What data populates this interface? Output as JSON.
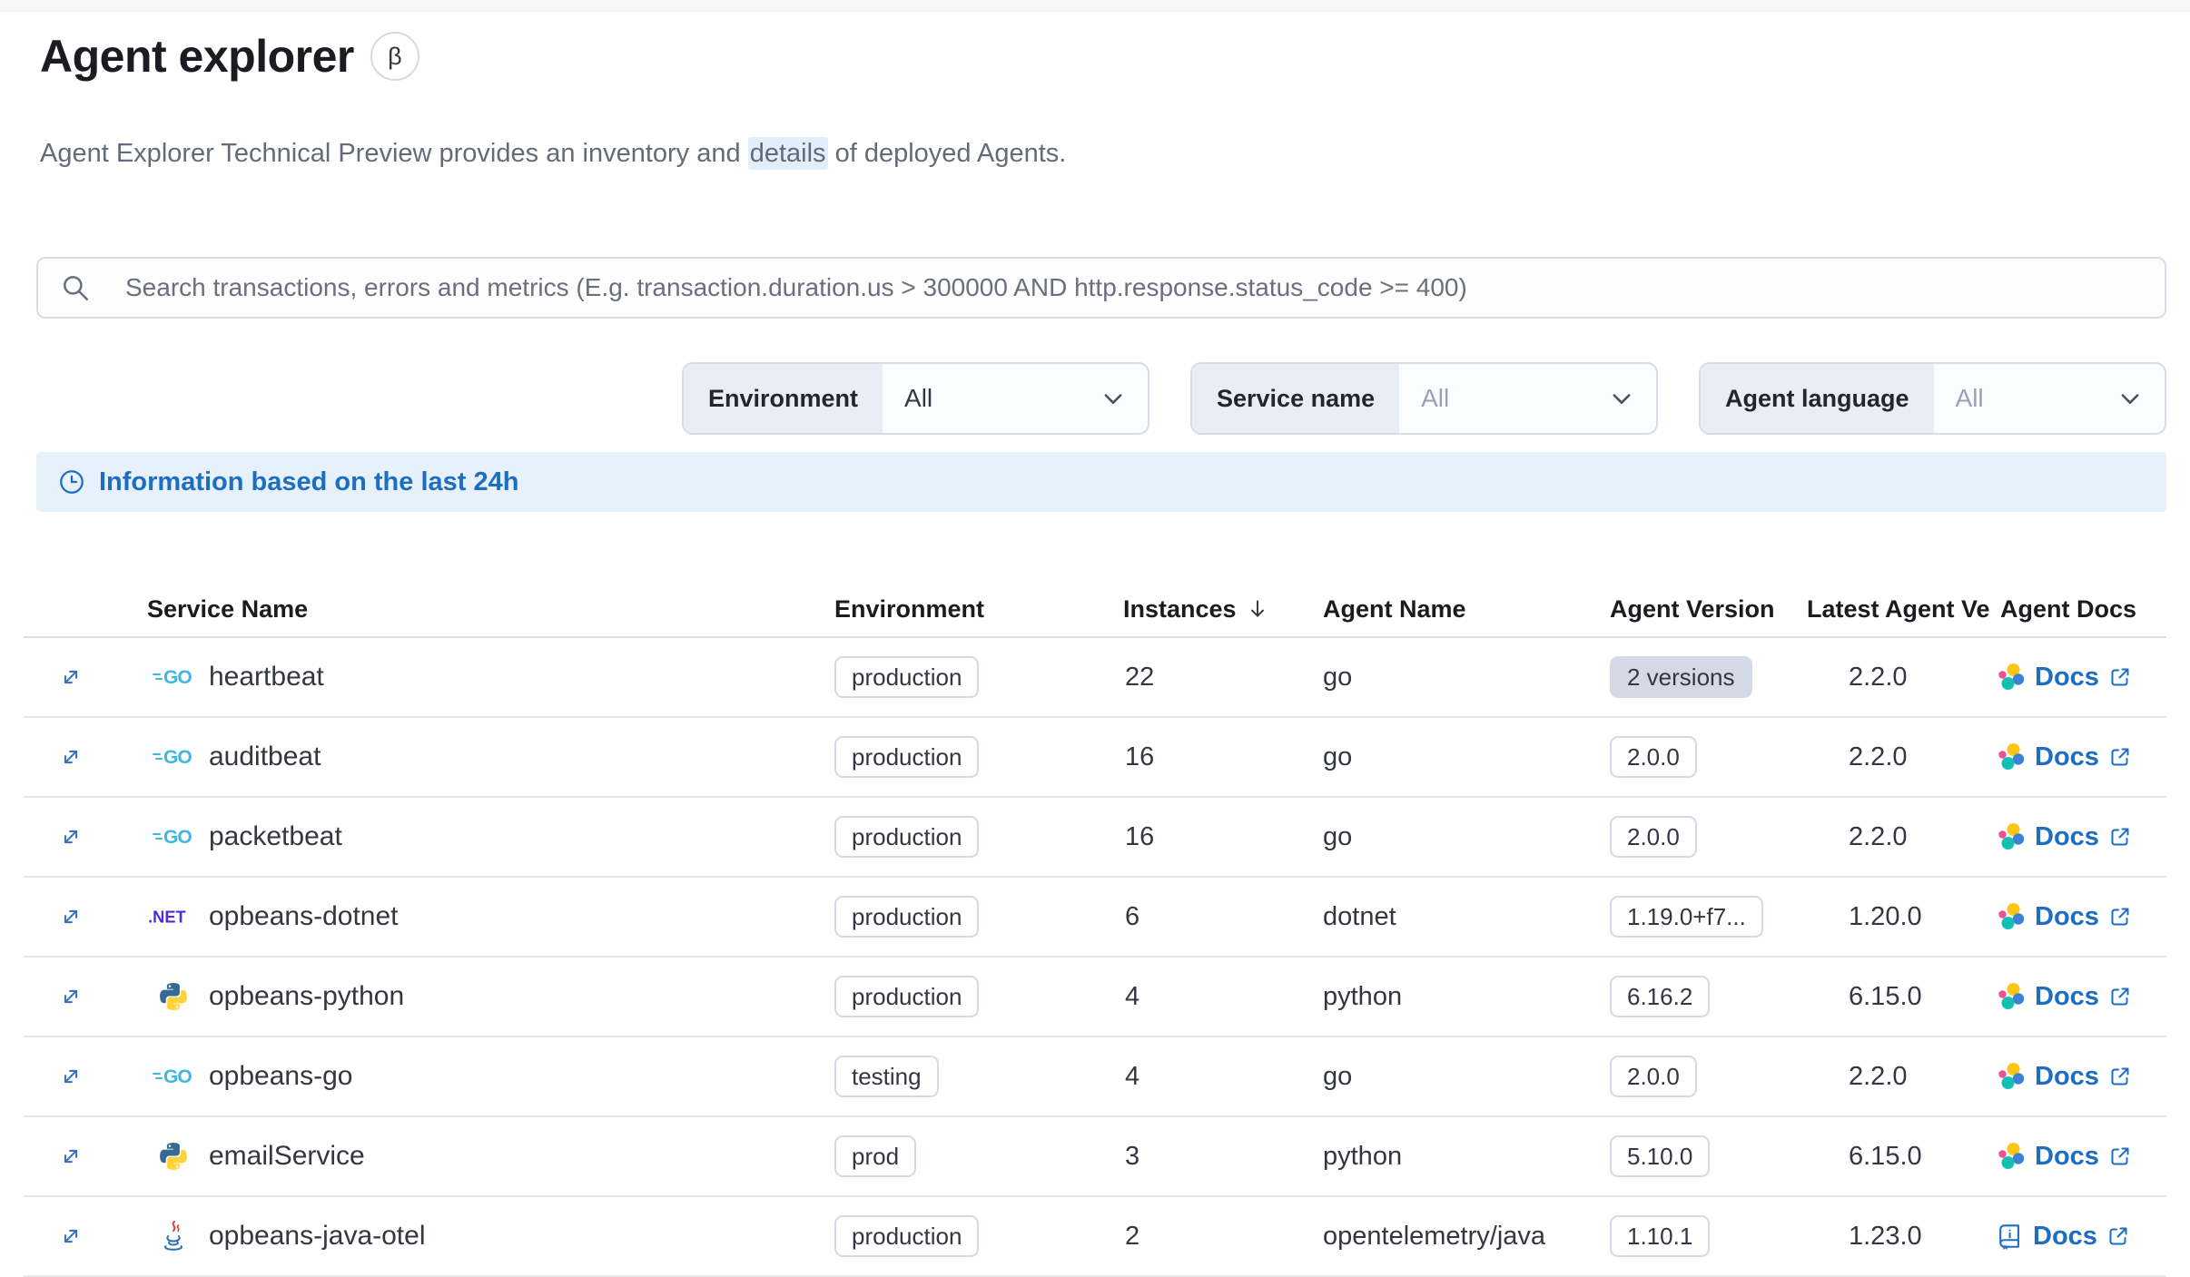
{
  "page": {
    "title": "Agent explorer",
    "beta_badge": "β",
    "subtitle": {
      "before": "Agent Explorer Technical Preview provides an inventory and ",
      "highlighted": "details",
      "after": " of deployed Agents."
    }
  },
  "search": {
    "placeholder": "Search transactions, errors and metrics (E.g. transaction.duration.us > 300000 AND http.response.status_code >= 400)",
    "icon": "search-icon"
  },
  "filters": [
    {
      "label": "Environment",
      "value": "All"
    },
    {
      "label": "Service name",
      "value": "All"
    },
    {
      "label": "Agent language",
      "value": "All"
    }
  ],
  "banner": {
    "icon": "clock-icon",
    "text": "Information based on the last 24h"
  },
  "table": {
    "columns": [
      {
        "label": "Service Name"
      },
      {
        "label": "Environment"
      },
      {
        "label": "Instances",
        "sorted": "desc"
      },
      {
        "label": "Agent Name"
      },
      {
        "label": "Agent Version"
      },
      {
        "label": "Latest Agent Ve"
      },
      {
        "label": "Agent Docs"
      }
    ],
    "rows": [
      {
        "service": "heartbeat",
        "language_icon": "go",
        "environment": "production",
        "instances": "22",
        "agent_name": "go",
        "agent_version": "2 versions",
        "version_badge": "filled",
        "latest_version": "2.2.0",
        "docs_label": "Docs",
        "docs_icon": "elastic-logo"
      },
      {
        "service": "auditbeat",
        "language_icon": "go",
        "environment": "production",
        "instances": "16",
        "agent_name": "go",
        "agent_version": "2.0.0",
        "version_badge": "outlined",
        "latest_version": "2.2.0",
        "docs_label": "Docs",
        "docs_icon": "elastic-logo"
      },
      {
        "service": "packetbeat",
        "language_icon": "go",
        "environment": "production",
        "instances": "16",
        "agent_name": "go",
        "agent_version": "2.0.0",
        "version_badge": "outlined",
        "latest_version": "2.2.0",
        "docs_label": "Docs",
        "docs_icon": "elastic-logo"
      },
      {
        "service": "opbeans-dotnet",
        "language_icon": "dotnet",
        "environment": "production",
        "instances": "6",
        "agent_name": "dotnet",
        "agent_version": "1.19.0+f7...",
        "version_badge": "outlined",
        "latest_version": "1.20.0",
        "docs_label": "Docs",
        "docs_icon": "elastic-logo"
      },
      {
        "service": "opbeans-python",
        "language_icon": "python",
        "environment": "production",
        "instances": "4",
        "agent_name": "python",
        "agent_version": "6.16.2",
        "version_badge": "outlined",
        "latest_version": "6.15.0",
        "docs_label": "Docs",
        "docs_icon": "elastic-logo"
      },
      {
        "service": "opbeans-go",
        "language_icon": "go",
        "environment": "testing",
        "instances": "4",
        "agent_name": "go",
        "agent_version": "2.0.0",
        "version_badge": "outlined",
        "latest_version": "2.2.0",
        "docs_label": "Docs",
        "docs_icon": "elastic-logo"
      },
      {
        "service": "emailService",
        "language_icon": "python",
        "environment": "prod",
        "instances": "3",
        "agent_name": "python",
        "agent_version": "5.10.0",
        "version_badge": "outlined",
        "latest_version": "6.15.0",
        "docs_label": "Docs",
        "docs_icon": "elastic-logo"
      },
      {
        "service": "opbeans-java-otel",
        "language_icon": "java",
        "environment": "production",
        "instances": "2",
        "agent_name": "opentelemetry/java",
        "agent_version": "1.10.1",
        "version_badge": "outlined",
        "latest_version": "1.23.0",
        "docs_label": "Docs",
        "docs_icon": "documentation"
      }
    ]
  },
  "colors": {
    "link_blue": "#1d6dc1",
    "banner_background": "#e7f1fb",
    "badge_border": "#d3dae6",
    "badge_fill": "#d3dae6",
    "highlight_background": "#e3eefb",
    "go_logo": "#41b6e6",
    "dotnet_logo": "#512bd4",
    "python_blue": "#366994",
    "python_yellow": "#ffd43b",
    "java_blue": "#2b6fb5",
    "java_red": "#d9413d",
    "elastic_yellow": "#fec514",
    "elastic_pink": "#f04e98",
    "elastic_blue": "#3b82d8",
    "elastic_teal": "#16bfb3"
  }
}
